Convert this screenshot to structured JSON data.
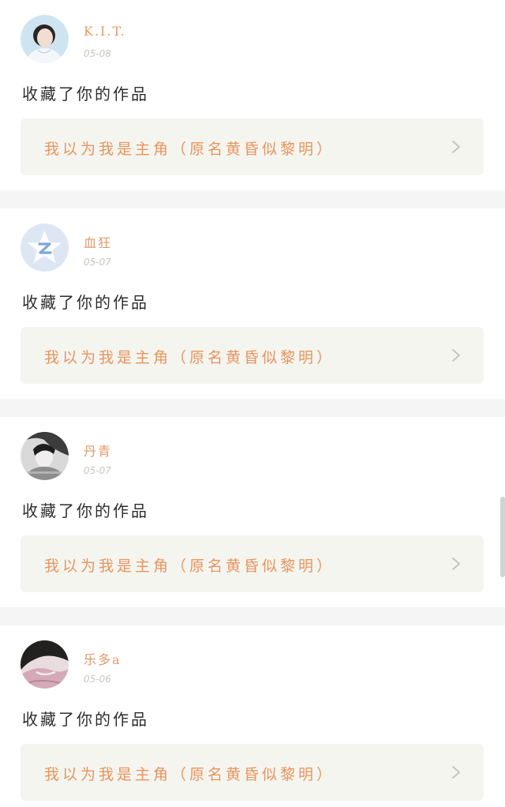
{
  "feed": {
    "items": [
      {
        "username": "K.I.T.",
        "date": "05-08",
        "action": "收藏了你的作品",
        "work_title": "我以为我是主角（原名黄昏似黎明）",
        "avatar_icon": "user-photo-avatar"
      },
      {
        "username": "血狂",
        "date": "05-07",
        "action": "收藏了你的作品",
        "work_title": "我以为我是主角（原名黄昏似黎明）",
        "avatar_icon": "default-z-star-avatar"
      },
      {
        "username": "丹青",
        "date": "05-07",
        "action": "收藏了你的作品",
        "work_title": "我以为我是主角（原名黄昏似黎明）",
        "avatar_icon": "user-photo-avatar"
      },
      {
        "username": "乐多a",
        "date": "05-06",
        "action": "收藏了你的作品",
        "work_title": "我以为我是主角（原名黄昏似黎明）",
        "avatar_icon": "user-photo-avatar"
      }
    ]
  },
  "colors": {
    "accent": "#e8945d",
    "username": "#e29a6b",
    "date": "#c8c6c2",
    "box_bg": "#f5f5f0",
    "separator": "#f6f5f5"
  },
  "icons": {
    "chevron": "chevron-right-icon"
  }
}
